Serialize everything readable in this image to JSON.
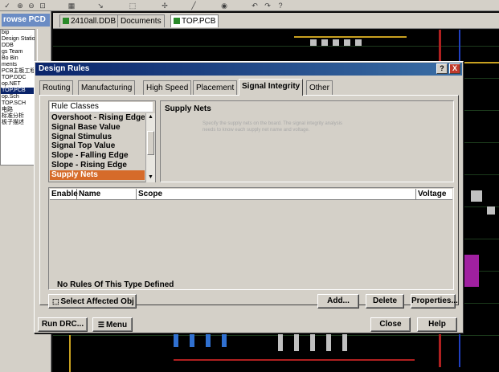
{
  "app": {
    "left_panel_title": "rowse PCD",
    "left_panel_items": [
      "bip",
      "Design Station",
      "DDB",
      "gs Team",
      "Bo Bin",
      "ments",
      "PCB主板工程",
      "TOP.DDC",
      "op.NET",
      "TOP.PCB",
      "op.Sch",
      "TOP.SCH",
      "电路",
      "标准分析",
      "板子描述"
    ],
    "doc_tabs": [
      "2410all.DDB",
      "Documents",
      "TOP.PCB"
    ]
  },
  "dialog": {
    "title": "Design Rules",
    "help_label": "?",
    "close_label": "X",
    "tabs": [
      "Routing",
      "Manufacturing",
      "High Speed",
      "Placement",
      "Signal Integrity",
      "Other"
    ],
    "active_tab": "Signal Integrity",
    "rule_classes_label": "Rule Classes",
    "rule_classes": [
      "Overshoot - Rising Edge",
      "Signal Base Value",
      "Signal Stimulus",
      "Signal Top Value",
      "Slope - Falling Edge",
      "Slope - Rising Edge",
      "Supply Nets"
    ],
    "selected_rule_class": "Supply Nets",
    "supply_nets_title": "Supply Nets",
    "supply_nets_description": "Specify the supply nets on the board. The signal integrity analysis needs to know each supply net name and voltage.",
    "table_columns": [
      "Enable",
      "Name",
      "Scope",
      "Voltage"
    ],
    "empty_message": "No Rules Of This Type Defined",
    "buttons": {
      "select_affected": "Select Affected Obj",
      "add": "Add...",
      "delete": "Delete",
      "properties": "Properties...",
      "run_drc": "Run DRC...",
      "menu": "Menu",
      "close": "Close",
      "help": "Help"
    }
  },
  "colors": {
    "title_bar": "#0a246a",
    "selection": "#d66b2a",
    "dialog_face": "#d4d0c8",
    "pcb_background": "#000000"
  }
}
